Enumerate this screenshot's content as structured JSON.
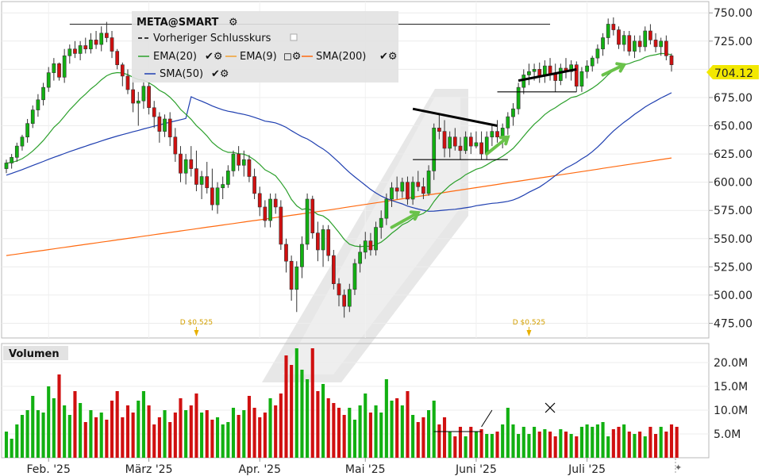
{
  "chart_data": {
    "type": "candlestick",
    "symbol_label": "META@SMART",
    "legend": {
      "prev_close_label": "Vorheriger Schlusskurs",
      "items": [
        {
          "label": "EMA(20)",
          "color": "#2ca02c"
        },
        {
          "label": "EMA(9)",
          "color": "#f0a030"
        },
        {
          "label": "SMA(200)",
          "color": "#ff6a10"
        },
        {
          "label": "SMA(50)",
          "color": "#1f3fb0"
        }
      ]
    },
    "y_ticks": [
      "750.00",
      "725.00",
      "700.00",
      "675.00",
      "650.00",
      "625.00",
      "600.00",
      "575.00",
      "550.00",
      "525.00",
      "500.00",
      "475.00"
    ],
    "y_range": [
      462,
      760
    ],
    "last_price": "704.12",
    "x_ticks": [
      {
        "label": "Feb. '25",
        "index": 8
      },
      {
        "label": "März '25",
        "index": 27
      },
      {
        "label": "Apr. '25",
        "index": 48
      },
      {
        "label": "Mai '25",
        "index": 68
      },
      {
        "label": "Juni '25",
        "index": 89
      },
      {
        "label": "Juli '25",
        "index": 110
      }
    ],
    "dividends": [
      {
        "label": "D $0.525",
        "index": 36
      },
      {
        "label": "D $0.525",
        "index": 99
      }
    ],
    "volume_title": "Volumen",
    "volume_ticks": [
      "20.0M",
      "15.0M",
      "10.0M",
      "5.0M"
    ],
    "volume_range": [
      0,
      23.5
    ],
    "candles": [
      [
        612,
        620,
        608,
        617
      ],
      [
        617,
        625,
        612,
        622
      ],
      [
        622,
        635,
        618,
        632
      ],
      [
        632,
        642,
        628,
        640
      ],
      [
        640,
        656,
        635,
        652
      ],
      [
        652,
        668,
        648,
        664
      ],
      [
        664,
        678,
        658,
        673
      ],
      [
        673,
        688,
        668,
        684
      ],
      [
        684,
        702,
        680,
        697
      ],
      [
        697,
        710,
        690,
        705
      ],
      [
        705,
        706,
        690,
        693
      ],
      [
        693,
        718,
        688,
        712
      ],
      [
        712,
        722,
        705,
        718
      ],
      [
        718,
        725,
        710,
        714
      ],
      [
        714,
        725,
        708,
        721
      ],
      [
        721,
        728,
        714,
        718
      ],
      [
        718,
        732,
        714,
        726
      ],
      [
        726,
        734,
        718,
        722
      ],
      [
        722,
        738,
        716,
        732
      ],
      [
        732,
        742,
        724,
        728
      ],
      [
        728,
        734,
        710,
        716
      ],
      [
        716,
        718,
        700,
        704
      ],
      [
        704,
        706,
        685,
        694
      ],
      [
        694,
        700,
        678,
        682
      ],
      [
        682,
        690,
        662,
        670
      ],
      [
        670,
        680,
        650,
        672
      ],
      [
        672,
        690,
        665,
        685
      ],
      [
        685,
        688,
        660,
        666
      ],
      [
        666,
        672,
        648,
        658
      ],
      [
        658,
        662,
        635,
        645
      ],
      [
        645,
        660,
        640,
        656
      ],
      [
        656,
        662,
        632,
        640
      ],
      [
        640,
        648,
        618,
        625
      ],
      [
        625,
        632,
        600,
        608
      ],
      [
        608,
        625,
        598,
        620
      ],
      [
        620,
        632,
        605,
        612
      ],
      [
        612,
        628,
        592,
        598
      ],
      [
        598,
        610,
        585,
        605
      ],
      [
        605,
        618,
        590,
        595
      ],
      [
        595,
        612,
        575,
        580
      ],
      [
        580,
        600,
        572,
        595
      ],
      [
        595,
        605,
        585,
        598
      ],
      [
        598,
        615,
        595,
        610
      ],
      [
        610,
        628,
        605,
        625
      ],
      [
        625,
        632,
        610,
        615
      ],
      [
        615,
        628,
        605,
        620
      ],
      [
        620,
        624,
        600,
        605
      ],
      [
        605,
        612,
        585,
        590
      ],
      [
        590,
        596,
        570,
        578
      ],
      [
        578,
        584,
        560,
        566
      ],
      [
        566,
        590,
        560,
        585
      ],
      [
        585,
        590,
        572,
        578
      ],
      [
        578,
        584,
        540,
        545
      ],
      [
        545,
        550,
        520,
        530
      ],
      [
        530,
        535,
        495,
        505
      ],
      [
        505,
        530,
        485,
        525
      ],
      [
        525,
        552,
        515,
        545
      ],
      [
        545,
        590,
        540,
        585
      ],
      [
        585,
        588,
        550,
        555
      ],
      [
        555,
        565,
        530,
        540
      ],
      [
        540,
        562,
        525,
        558
      ],
      [
        558,
        562,
        530,
        535
      ],
      [
        535,
        540,
        505,
        510
      ],
      [
        510,
        515,
        490,
        500
      ],
      [
        500,
        505,
        480,
        490
      ],
      [
        490,
        510,
        485,
        505
      ],
      [
        505,
        532,
        500,
        528
      ],
      [
        528,
        545,
        520,
        538
      ],
      [
        538,
        556,
        532,
        548
      ],
      [
        548,
        555,
        535,
        540
      ],
      [
        540,
        565,
        535,
        560
      ],
      [
        560,
        575,
        550,
        568
      ],
      [
        568,
        590,
        562,
        585
      ],
      [
        585,
        600,
        578,
        595
      ],
      [
        595,
        605,
        585,
        592
      ],
      [
        592,
        604,
        586,
        600
      ],
      [
        600,
        605,
        580,
        585
      ],
      [
        585,
        605,
        580,
        600
      ],
      [
        600,
        610,
        592,
        596
      ],
      [
        596,
        604,
        585,
        590
      ],
      [
        590,
        615,
        588,
        610
      ],
      [
        610,
        652,
        602,
        648
      ],
      [
        648,
        660,
        638,
        645
      ],
      [
        645,
        655,
        622,
        630
      ],
      [
        630,
        645,
        622,
        640
      ],
      [
        640,
        648,
        628,
        632
      ],
      [
        632,
        640,
        620,
        628
      ],
      [
        628,
        645,
        625,
        640
      ],
      [
        640,
        644,
        625,
        632
      ],
      [
        632,
        645,
        630,
        635
      ],
      [
        635,
        645,
        620,
        625
      ],
      [
        625,
        645,
        620,
        640
      ],
      [
        640,
        650,
        632,
        645
      ],
      [
        645,
        655,
        635,
        640
      ],
      [
        640,
        652,
        630,
        648
      ],
      [
        648,
        662,
        642,
        658
      ],
      [
        658,
        670,
        650,
        665
      ],
      [
        665,
        688,
        660,
        684
      ],
      [
        684,
        700,
        678,
        695
      ],
      [
        695,
        705,
        686,
        698
      ],
      [
        698,
        705,
        690,
        700
      ],
      [
        700,
        706,
        688,
        694
      ],
      [
        694,
        708,
        688,
        703
      ],
      [
        703,
        710,
        690,
        696
      ],
      [
        696,
        705,
        680,
        690
      ],
      [
        690,
        705,
        686,
        701
      ],
      [
        701,
        710,
        692,
        698
      ],
      [
        698,
        708,
        690,
        704
      ],
      [
        704,
        707,
        680,
        685
      ],
      [
        685,
        702,
        680,
        698
      ],
      [
        698,
        708,
        692,
        703
      ],
      [
        703,
        712,
        698,
        710
      ],
      [
        710,
        722,
        705,
        718
      ],
      [
        718,
        732,
        712,
        728
      ],
      [
        728,
        745,
        722,
        740
      ],
      [
        740,
        746,
        730,
        735
      ],
      [
        735,
        738,
        718,
        722
      ],
      [
        722,
        734,
        716,
        730
      ],
      [
        730,
        734,
        712,
        716
      ],
      [
        716,
        730,
        710,
        725
      ],
      [
        725,
        730,
        715,
        720
      ],
      [
        720,
        738,
        716,
        734
      ],
      [
        734,
        740,
        722,
        726
      ],
      [
        726,
        732,
        715,
        720
      ],
      [
        720,
        728,
        712,
        725
      ],
      [
        725,
        730,
        708,
        712
      ],
      [
        712,
        714,
        698,
        704
      ]
    ],
    "volumes": [
      5.5,
      4.0,
      7.0,
      9.0,
      10.0,
      13.0,
      10.0,
      9.5,
      15.0,
      12.5,
      17.5,
      11.0,
      9.0,
      14.0,
      11.5,
      7.5,
      10.0,
      8.5,
      9.5,
      8.0,
      12.0,
      14.0,
      8.5,
      11.0,
      9.5,
      12.0,
      14.0,
      11.0,
      7.0,
      8.5,
      10.0,
      7.5,
      9.5,
      12.5,
      10.0,
      11.0,
      13.5,
      9.5,
      10.0,
      8.0,
      8.5,
      7.0,
      7.5,
      10.5,
      9.0,
      10.0,
      13.0,
      10.5,
      8.5,
      9.5,
      12.5,
      11.0,
      13.5,
      21.5,
      19.5,
      23.0,
      18.5,
      16.5,
      23.0,
      14.0,
      15.5,
      12.5,
      11.5,
      10.5,
      9.0,
      10.5,
      8.0,
      11.0,
      13.5,
      9.5,
      11.0,
      9.5,
      16.5,
      12.0,
      12.5,
      11.0,
      14.0,
      9.0,
      7.5,
      8.5,
      10.0,
      12.0,
      7.0,
      8.5,
      5.5,
      4.5,
      6.5,
      4.5,
      6.5,
      5.5,
      6.0,
      5.0,
      5.0,
      5.5,
      7.0,
      10.5,
      7.0,
      5.0,
      6.5,
      5.0,
      6.5,
      5.5,
      6.0,
      5.5,
      4.5,
      6.0,
      5.5,
      5.0,
      4.5,
      6.5,
      7.0,
      6.5,
      7.0,
      7.5,
      4.5,
      6.0,
      6.5,
      7.0,
      5.5,
      5.0,
      5.5,
      4.5,
      6.5,
      5.0,
      6.5,
      5.5,
      7.0,
      6.5
    ]
  }
}
